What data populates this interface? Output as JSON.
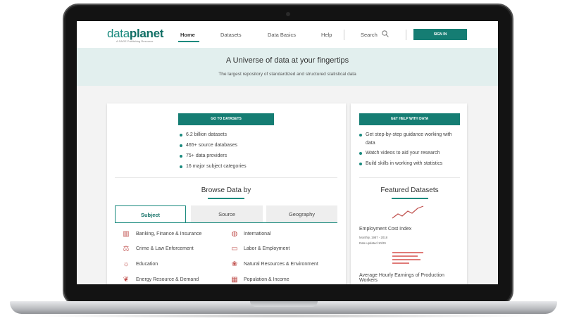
{
  "nav": {
    "logo_light": "data",
    "logo_bold": "planet",
    "logo_sub": "A SAGE Publishing Resource",
    "links": [
      "Home",
      "Datasets",
      "Data Basics",
      "Help"
    ],
    "search_label": "Search",
    "signin_label": "SIGN IN"
  },
  "hero": {
    "title": "A Universe of data at your fingertips",
    "subtitle": "The largest repository of standardized and structured statistical data"
  },
  "datasets_card": {
    "button_label": "GO TO DATASETS",
    "bullets": [
      "6.2 billion datasets",
      "465+ source databases",
      "75+ data providers",
      "16 major subject categories"
    ],
    "browse_title": "Browse Data by",
    "tabs": [
      "Subject",
      "Source",
      "Geography"
    ],
    "subjects_left": [
      "Banking, Finance & Insurance",
      "Crime & Law Enforcement",
      "Education",
      "Energy Resource & Demand"
    ],
    "subjects_right": [
      "International",
      "Labor & Employment",
      "Natural Resources & Environment",
      "Population & Income"
    ]
  },
  "help_card": {
    "button_label": "GET HELP WITH DATA",
    "bullets": [
      "Get step-by-step guidance working with data",
      "Watch videos to aid your research",
      "Build skills in working with statistics"
    ],
    "featured_title": "Featured Datasets",
    "featured": [
      {
        "name": "Employment Cost Index",
        "meta1": "Monthly, 1987 - 2018",
        "meta2": "Date updated 10/29"
      },
      {
        "name": "Average Hourly Earnings of Production Workers"
      }
    ]
  },
  "colors": {
    "accent": "#157d73",
    "hero_bg": "#e2efee",
    "icon": "#c0504d"
  },
  "icons": {
    "subjects_left": [
      "bank-icon",
      "scales-icon",
      "lightbulb-icon",
      "leaf-icon"
    ],
    "subjects_right": [
      "globe-icon",
      "briefcase-icon",
      "tree-icon",
      "building-icon"
    ]
  }
}
